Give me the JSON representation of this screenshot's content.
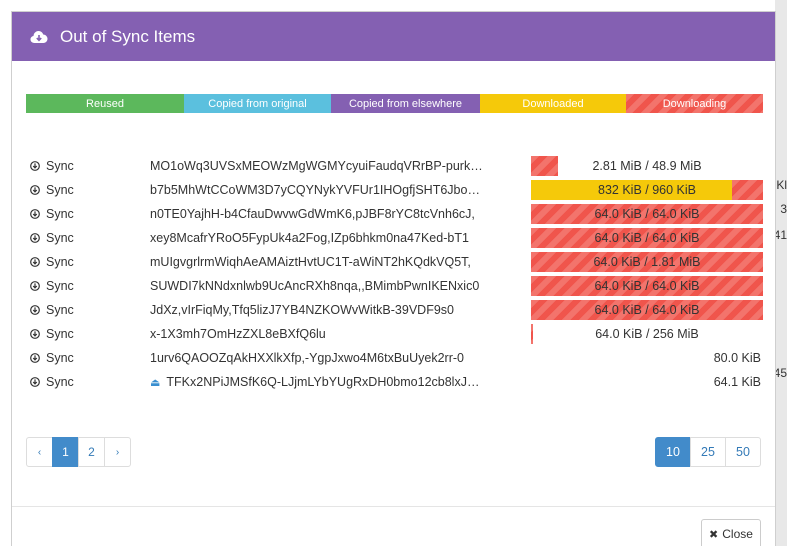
{
  "dialog": {
    "title": "Out of Sync Items",
    "close_label": "Close"
  },
  "legend": [
    {
      "label": "Reused",
      "color": "#5cb85c"
    },
    {
      "label": "Copied from original",
      "color": "#5bc0de"
    },
    {
      "label": "Copied from elsewhere",
      "color": "#8460b2"
    },
    {
      "label": "Downloaded",
      "color": "#f5c90a"
    },
    {
      "label": "Downloading",
      "color": "#f0554c"
    }
  ],
  "colors": {
    "header": "#8460b2",
    "downloaded": "#f5c90a",
    "downloading": "#f0554c",
    "pagination_active": "#428bca"
  },
  "rows": [
    {
      "action": "Sync",
      "name": "MO1oWq3UVSxMEOWzMgWGMYcyuiFaudqVRrBP-purk…",
      "progress": "2.81 MiB / 48.9 MiB",
      "downloaded": 0,
      "downloading": 0.117
    },
    {
      "action": "Sync",
      "name": "b7b5MhWtCCoWM3D7yCQYNykYVFUr1IHOgfjSHT6Jbo…",
      "progress": "832 KiB / 960 KiB",
      "downloaded": 0.867,
      "downloading": 0.133
    },
    {
      "action": "Sync",
      "name": "n0TE0YajhH-b4CfauDwvwGdWmK6,pJBF8rYC8tcVnh6cJ,",
      "progress": "64.0 KiB / 64.0 KiB",
      "downloaded": 0,
      "downloading": 1.0
    },
    {
      "action": "Sync",
      "name": "xey8McafrYRoO5FypUk4a2Fog,IZp6bhkm0na47Ked-bT1",
      "progress": "64.0 KiB / 64.0 KiB",
      "downloaded": 0,
      "downloading": 1.0
    },
    {
      "action": "Sync",
      "name": "mUIgvgrlrmWiqhAeAMAiztHvtUC1T-aWiNT2hKQdkVQ5T,",
      "progress": "64.0 KiB / 1.81 MiB",
      "downloaded": 0,
      "downloading": 1.0
    },
    {
      "action": "Sync",
      "name": "SUWDI7kNNdxnlwb9UcAncRXh8nqa,,BMimbPwnIKENxic0",
      "progress": "64.0 KiB / 64.0 KiB",
      "downloaded": 0,
      "downloading": 1.0
    },
    {
      "action": "Sync",
      "name": "JdXz,vIrFiqMy,Tfq5lizJ7YB4NZKOWvWitkB-39VDF9s0",
      "progress": "64.0 KiB / 64.0 KiB",
      "downloaded": 0,
      "downloading": 1.0
    },
    {
      "action": "Sync",
      "name": "x-1X3mh7OmHzZXL8eBXfQ6lu",
      "progress": "64.0 KiB / 256 MiB",
      "downloaded": 0,
      "downloading": 0.01
    },
    {
      "action": "Sync",
      "name": "1urv6QAOOZqAkHXXlkXfp,-YgpJxwo4M6txBuUyek2rr-0",
      "size": "80.0 KiB"
    },
    {
      "action": "Sync",
      "name": "TFKx2NPiJMSfK6Q-LJjmLYbYUgRxDH0bmo12cb8lxJ…",
      "size": "64.1 KiB",
      "icon": "eject-icon"
    }
  ],
  "pagination": {
    "prev": "‹",
    "pages": [
      "1",
      "2"
    ],
    "current": "1",
    "next": "›"
  },
  "per_page": {
    "options": [
      "10",
      "25",
      "50"
    ],
    "selected": "10"
  }
}
